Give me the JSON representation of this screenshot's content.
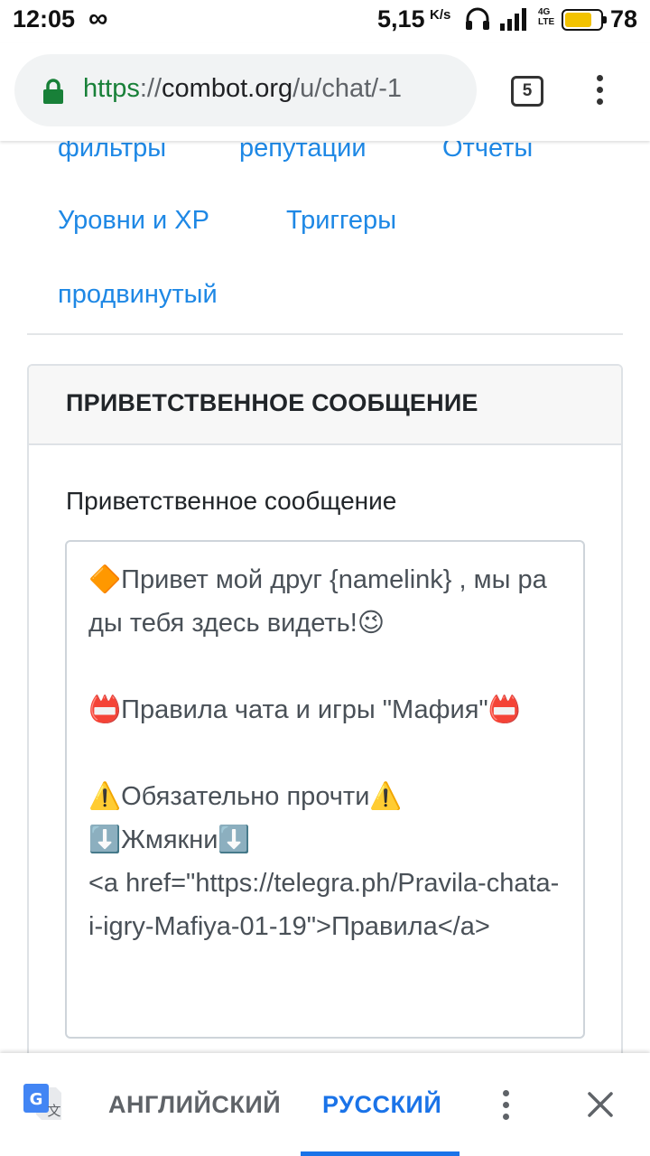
{
  "status_bar": {
    "time": "12:05",
    "loop_glyph": "∞",
    "net_speed": "5,15",
    "net_speed_unit": "K/s",
    "lte_label": "4G LTE",
    "battery_percent": 78,
    "battery_text": "78",
    "battery_color": "#f2c200"
  },
  "browser": {
    "url_scheme": "https",
    "url_sep": "://",
    "url_host": "combot.org",
    "url_path": "/u/chat/-1",
    "tab_count": "5",
    "lock_icon": "lock-icon",
    "menu_icon": "more-vert-icon"
  },
  "nav": {
    "row1": [
      "фильтры",
      "репутации",
      "Отчеты"
    ],
    "row2": [
      "Уровни и XP",
      "Триггеры"
    ],
    "row3": [
      "продвинутый"
    ]
  },
  "card": {
    "title": "ПРИВЕТСТВЕННОЕ СООБЩЕНИЕ",
    "field_label": "Приветственное сообщение",
    "field_value": "🔶Привет мой друг {namelink} , мы рады тебя здесь видеть!😉\n\n📛Правила чата и игры \"Мафия\"📛\n\n⚠️Обязательно прочти⚠️\n⬇️Жмякни⬇️\n<a href=\"https://telegra.ph/Pravila-chata-i-igry-Mafiya-01-19\">Правила</a>"
  },
  "translate_bar": {
    "source_lang": "АНГЛИЙСКИЙ",
    "target_lang": "РУССКИЙ",
    "accent_color": "#1a73e8"
  }
}
